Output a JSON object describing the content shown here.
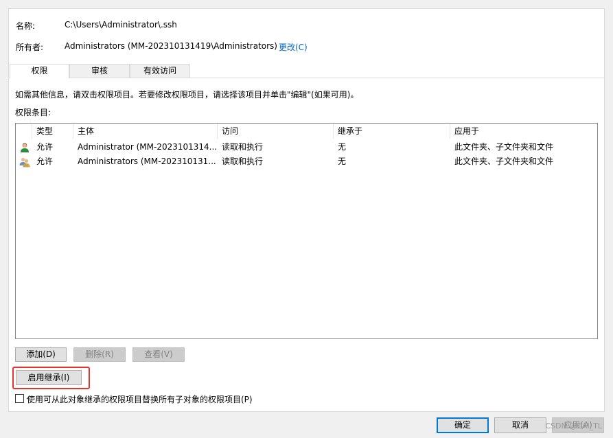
{
  "dialog": {
    "name_label": "名称:",
    "name_value": "C:\\Users\\Administrator\\.ssh",
    "owner_label": "所有者:",
    "owner_value": "Administrators (MM-202310131419\\Administrators)",
    "change_link": "更改(C)"
  },
  "tabs": [
    {
      "label": "权限",
      "active": true
    },
    {
      "label": "审核",
      "active": false
    },
    {
      "label": "有效访问",
      "active": false
    }
  ],
  "info_text": "如需其他信息，请双击权限项目。若要修改权限项目，请选择该项目并单击\"编辑\"(如果可用)。",
  "entries_label": "权限条目:",
  "table": {
    "columns": [
      "类型",
      "主体",
      "访问",
      "继承于",
      "应用于"
    ],
    "rows": [
      {
        "icon": "user-icon",
        "type": "允许",
        "principal": "Administrator (MM-2023101314...",
        "access": "读取和执行",
        "inherited": "无",
        "applies": "此文件夹、子文件夹和文件"
      },
      {
        "icon": "group-icon",
        "type": "允许",
        "principal": "Administrators (MM-202310131...",
        "access": "读取和执行",
        "inherited": "无",
        "applies": "此文件夹、子文件夹和文件"
      }
    ]
  },
  "buttons": {
    "add": "添加(D)",
    "remove": "删除(R)",
    "view": "查看(V)",
    "enable_inheritance": "启用继承(I)",
    "ok": "确定",
    "cancel": "取消",
    "apply": "应用(A)"
  },
  "checkbox_label": "使用可从此对象继承的权限项目替换所有子对象的权限项目(P)",
  "watermark": "CSDN @CAI_TL",
  "colors": {
    "highlight": "#e8342c",
    "link": "#0066cc",
    "default_button_border": "#0078d7"
  }
}
